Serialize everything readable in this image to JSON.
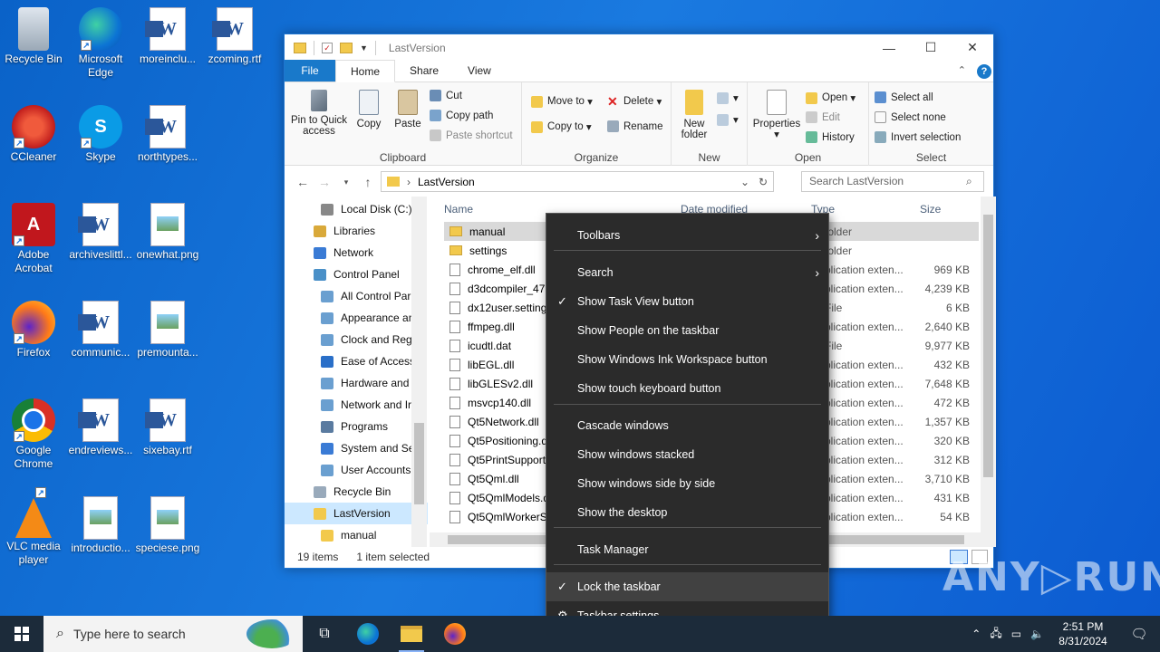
{
  "desktop": {
    "icons": [
      {
        "label": "Recycle Bin",
        "icon": "recycle-bin-icon"
      },
      {
        "label": "Microsoft Edge",
        "icon": "edge-icon"
      },
      {
        "label": "moreinclu...",
        "icon": "word-document-icon"
      },
      {
        "label": "zcoming.rtf",
        "icon": "word-document-icon"
      },
      {
        "label": "CCleaner",
        "icon": "ccleaner-icon"
      },
      {
        "label": "Skype",
        "icon": "skype-icon"
      },
      {
        "label": "northtypes...",
        "icon": "word-document-icon"
      },
      {
        "label": "Adobe Acrobat",
        "icon": "acrobat-icon"
      },
      {
        "label": "archiveslittl...",
        "icon": "word-document-icon"
      },
      {
        "label": "onewhat.png",
        "icon": "image-file-icon"
      },
      {
        "label": "Firefox",
        "icon": "firefox-icon"
      },
      {
        "label": "communic...",
        "icon": "word-document-icon"
      },
      {
        "label": "premounta...",
        "icon": "image-file-icon"
      },
      {
        "label": "Google Chrome",
        "icon": "chrome-icon"
      },
      {
        "label": "endreviews...",
        "icon": "word-document-icon"
      },
      {
        "label": "sixebay.rtf",
        "icon": "word-document-icon"
      },
      {
        "label": "VLC media player",
        "icon": "vlc-icon"
      },
      {
        "label": "introductio...",
        "icon": "image-file-icon"
      },
      {
        "label": "speciese.png",
        "icon": "image-file-icon"
      }
    ]
  },
  "explorer": {
    "title": "LastVersion",
    "tabs": [
      "File",
      "Home",
      "Share",
      "View"
    ],
    "active_tab": "Home",
    "ribbon": {
      "clipboard": {
        "name": "Clipboard",
        "pin": "Pin to Quick access",
        "copy": "Copy",
        "paste": "Paste",
        "cut": "Cut",
        "copy_path": "Copy path",
        "paste_shortcut": "Paste shortcut"
      },
      "organize": {
        "name": "Organize",
        "move_to": "Move to",
        "copy_to": "Copy to",
        "delete": "Delete",
        "rename": "Rename"
      },
      "new": {
        "name": "New",
        "new_folder": "New folder"
      },
      "open": {
        "name": "Open",
        "properties": "Properties",
        "open": "Open",
        "edit": "Edit",
        "history": "History"
      },
      "select": {
        "name": "Select",
        "select_all": "Select all",
        "select_none": "Select none",
        "invert": "Invert selection"
      }
    },
    "address": {
      "path": "LastVersion",
      "search_placeholder": "Search LastVersion"
    },
    "nav_items": [
      {
        "label": "Local Disk (C:)",
        "indent": 1
      },
      {
        "label": "Libraries",
        "indent": 0
      },
      {
        "label": "Network",
        "indent": 0
      },
      {
        "label": "Control Panel",
        "indent": 0
      },
      {
        "label": "All Control Par",
        "indent": 1
      },
      {
        "label": "Appearance an",
        "indent": 1
      },
      {
        "label": "Clock and Regi",
        "indent": 1
      },
      {
        "label": "Ease of Access",
        "indent": 1
      },
      {
        "label": "Hardware and",
        "indent": 1
      },
      {
        "label": "Network and Ir",
        "indent": 1
      },
      {
        "label": "Programs",
        "indent": 1
      },
      {
        "label": "System and Se",
        "indent": 1
      },
      {
        "label": "User Accounts",
        "indent": 1
      },
      {
        "label": "Recycle Bin",
        "indent": 0
      },
      {
        "label": "LastVersion",
        "indent": 0
      },
      {
        "label": "manual",
        "indent": 1
      }
    ],
    "columns": {
      "name": "Name",
      "date": "Date modified",
      "type": "Type",
      "size": "Size"
    },
    "files": [
      {
        "name": "manual",
        "type": "folder",
        "size": "",
        "folder": true
      },
      {
        "name": "settings",
        "type": "folder",
        "size": "",
        "folder": true
      },
      {
        "name": "chrome_elf.dll",
        "type": "plication exten...",
        "size": "969 KB"
      },
      {
        "name": "d3dcompiler_47.c",
        "type": "plication exten...",
        "size": "4,239 KB"
      },
      {
        "name": "dx12user.settings",
        "type": "File",
        "size": "6 KB"
      },
      {
        "name": "ffmpeg.dll",
        "type": "plication exten...",
        "size": "2,640 KB"
      },
      {
        "name": "icudtl.dat",
        "type": "File",
        "size": "9,977 KB"
      },
      {
        "name": "libEGL.dll",
        "type": "plication exten...",
        "size": "432 KB"
      },
      {
        "name": "libGLESv2.dll",
        "type": "plication exten...",
        "size": "7,648 KB"
      },
      {
        "name": "msvcp140.dll",
        "type": "plication exten...",
        "size": "472 KB"
      },
      {
        "name": "Qt5Network.dll",
        "type": "plication exten...",
        "size": "1,357 KB"
      },
      {
        "name": "Qt5Positioning.dll",
        "type": "plication exten...",
        "size": "320 KB"
      },
      {
        "name": "Qt5PrintSupport.d",
        "type": "plication exten...",
        "size": "312 KB"
      },
      {
        "name": "Qt5Qml.dll",
        "type": "plication exten...",
        "size": "3,710 KB"
      },
      {
        "name": "Qt5QmlModels.dl",
        "type": "plication exten...",
        "size": "431 KB"
      },
      {
        "name": "Qt5QmlWorkerSc",
        "type": "plication exten...",
        "size": "54 KB"
      }
    ],
    "status": {
      "count": "19 items",
      "selected": "1 item selected"
    }
  },
  "context_menu": {
    "items": [
      {
        "label": "Toolbars",
        "submenu": true
      },
      {
        "label": "Search",
        "submenu": true
      },
      {
        "label": "Show Task View button",
        "checked": true
      },
      {
        "label": "Show People on the taskbar"
      },
      {
        "label": "Show Windows Ink Workspace button"
      },
      {
        "label": "Show touch keyboard button"
      },
      {
        "label": "Cascade windows"
      },
      {
        "label": "Show windows stacked"
      },
      {
        "label": "Show windows side by side"
      },
      {
        "label": "Show the desktop"
      },
      {
        "label": "Task Manager"
      },
      {
        "label": "Lock the taskbar",
        "checked": true,
        "highlighted": true
      },
      {
        "label": "Taskbar settings",
        "gear": true
      }
    ]
  },
  "taskbar": {
    "search_placeholder": "Type here to search",
    "time": "2:51 PM",
    "date": "8/31/2024"
  },
  "watermark": "ANY▷RUN"
}
